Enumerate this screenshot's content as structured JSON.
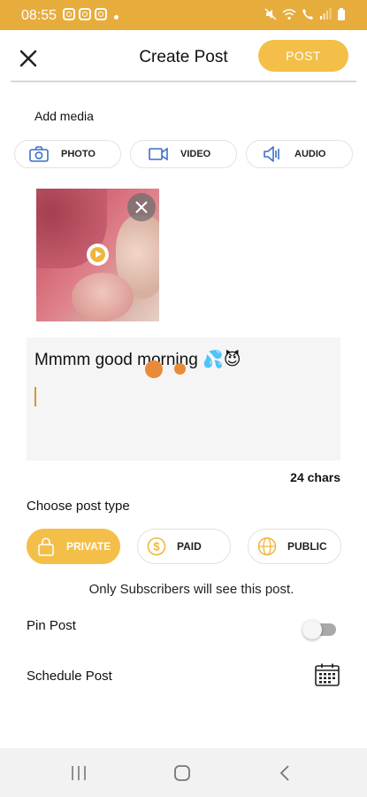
{
  "status_bar": {
    "time": "08:55"
  },
  "header": {
    "title": "Create Post",
    "post_label": "POST"
  },
  "add_media": {
    "label": "Add media",
    "buttons": [
      {
        "label": "PHOTO",
        "icon": "camera-icon"
      },
      {
        "label": "VIDEO",
        "icon": "video-camera-icon"
      },
      {
        "label": "AUDIO",
        "icon": "speaker-icon"
      }
    ]
  },
  "composer": {
    "text": "Mmmm good morning 💦😈",
    "char_count": "24 chars"
  },
  "post_type": {
    "label": "Choose post type",
    "options": [
      {
        "label": "PRIVATE",
        "icon": "lock-icon",
        "selected": true
      },
      {
        "label": "PAID",
        "icon": "dollar-icon",
        "selected": false
      },
      {
        "label": "PUBLIC",
        "icon": "globe-icon",
        "selected": false
      }
    ],
    "note": "Only Subscribers will see this post."
  },
  "settings": {
    "pin_label": "Pin Post",
    "pin_enabled": false,
    "schedule_label": "Schedule Post"
  },
  "colors": {
    "accent": "#f4bf48",
    "status_bar": "#e7ad3c",
    "icon_blue": "#3d6fc5"
  }
}
